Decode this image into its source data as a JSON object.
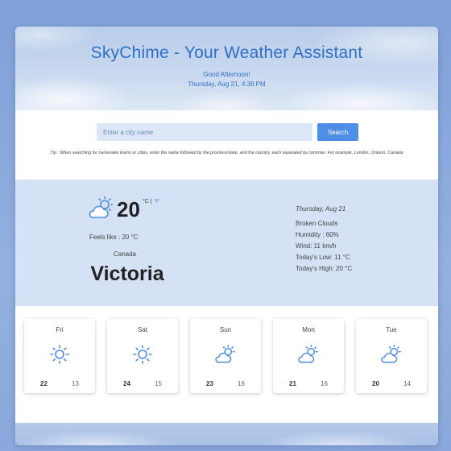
{
  "header": {
    "title": "SkyChime - Your Weather Assistant",
    "greeting": "Good Afternoon!",
    "datetime": "Thursday, Aug 21, 4:38 PM"
  },
  "search": {
    "placeholder": "Enter a city name",
    "button_label": "Search",
    "tip": "Tip : When searching for namesake towns or cities, enter the name followed by the province/state, and the country, each separated by commas. For example, London, Ontario, Canada."
  },
  "current": {
    "icon": "partly-cloudy-sun-icon",
    "temperature": "20",
    "unit_c": "°C",
    "unit_sep": " | ",
    "unit_f": "°F",
    "feels_like": "Feels like : 20 °C",
    "country": "Canada",
    "city": "Victoria",
    "date": "Thursday, Aug 21",
    "description": "Broken Clouds",
    "humidity": "Humidity : 60%",
    "wind": "Wind: 11 km/h",
    "low": "Today's Low: 11 °C",
    "high": "Today's High: 20 °C"
  },
  "forecast": [
    {
      "day": "Fri",
      "icon": "sun-icon",
      "high": "22",
      "low": "13"
    },
    {
      "day": "Sat",
      "icon": "sun-icon",
      "high": "24",
      "low": "15"
    },
    {
      "day": "Sun",
      "icon": "partly-cloudy-sun-icon",
      "high": "23",
      "low": "16"
    },
    {
      "day": "Mon",
      "icon": "partly-cloudy-sun-icon",
      "high": "21",
      "low": "16"
    },
    {
      "day": "Tue",
      "icon": "partly-cloudy-sun-icon",
      "high": "20",
      "low": "14"
    }
  ],
  "colors": {
    "accent": "#4f8ee6",
    "title": "#2f6fc7",
    "panel": "#d5e2f6"
  }
}
